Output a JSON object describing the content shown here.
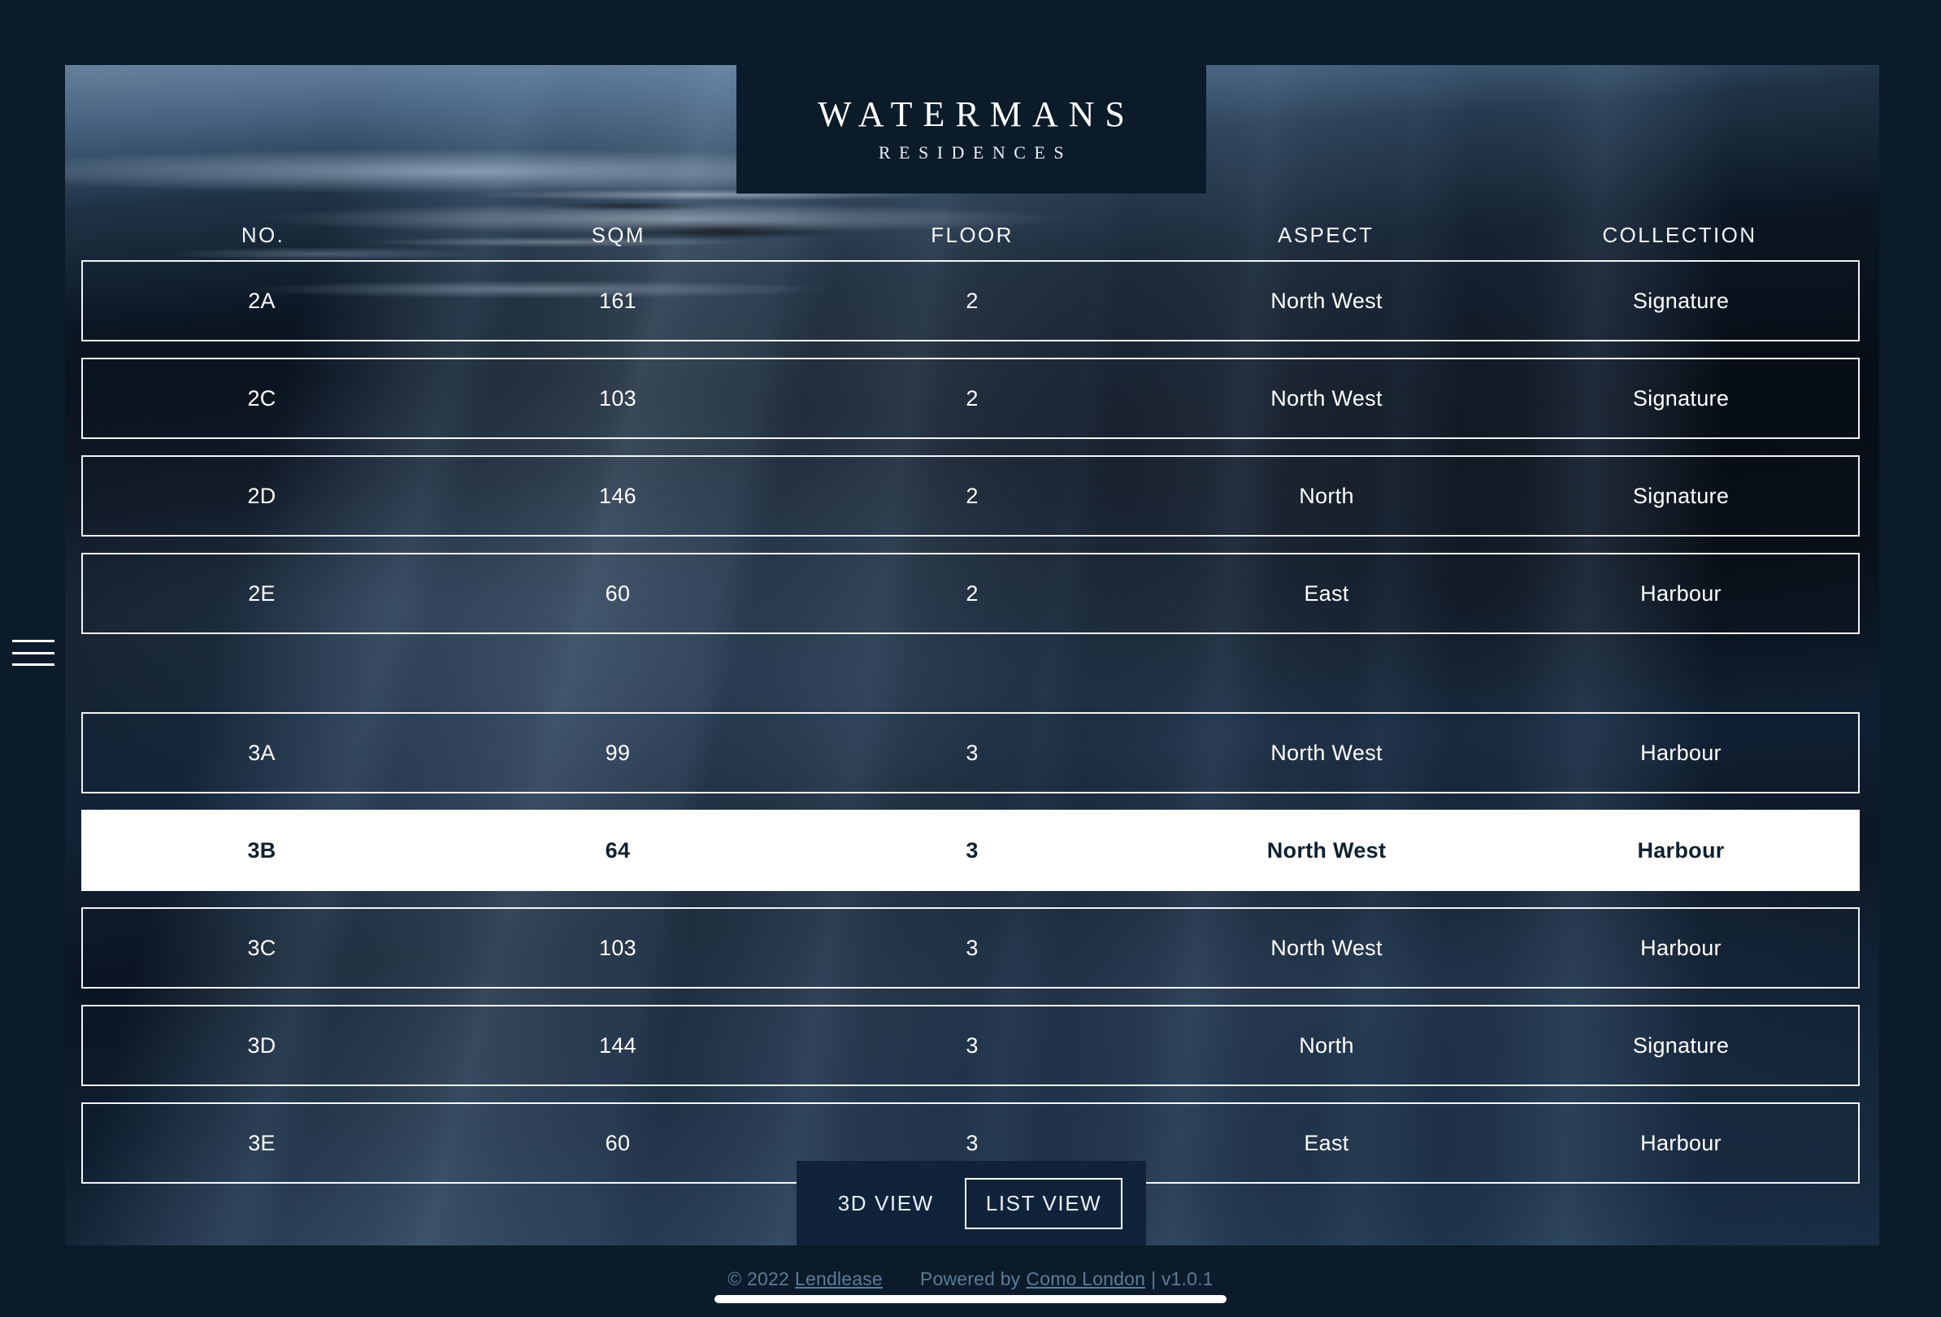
{
  "brand": {
    "name": "WATERMANS",
    "sub": "RESIDENCES"
  },
  "menu": {
    "label": "menu"
  },
  "table": {
    "headers": {
      "no": "NO.",
      "sqm": "SQM",
      "floor": "FLOOR",
      "aspect": "ASPECT",
      "collection": "COLLECTION"
    },
    "groups": [
      {
        "floor": "2",
        "rows": [
          {
            "no": "2A",
            "sqm": "161",
            "floor": "2",
            "aspect": "North West",
            "collection": "Signature",
            "selected": false
          },
          {
            "no": "2C",
            "sqm": "103",
            "floor": "2",
            "aspect": "North West",
            "collection": "Signature",
            "selected": false
          },
          {
            "no": "2D",
            "sqm": "146",
            "floor": "2",
            "aspect": "North",
            "collection": "Signature",
            "selected": false
          },
          {
            "no": "2E",
            "sqm": "60",
            "floor": "2",
            "aspect": "East",
            "collection": "Harbour",
            "selected": false
          }
        ]
      },
      {
        "floor": "3",
        "rows": [
          {
            "no": "3A",
            "sqm": "99",
            "floor": "3",
            "aspect": "North West",
            "collection": "Harbour",
            "selected": false
          },
          {
            "no": "3B",
            "sqm": "64",
            "floor": "3",
            "aspect": "North West",
            "collection": "Harbour",
            "selected": true
          },
          {
            "no": "3C",
            "sqm": "103",
            "floor": "3",
            "aspect": "North West",
            "collection": "Harbour",
            "selected": false
          },
          {
            "no": "3D",
            "sqm": "144",
            "floor": "3",
            "aspect": "North",
            "collection": "Signature",
            "selected": false
          },
          {
            "no": "3E",
            "sqm": "60",
            "floor": "3",
            "aspect": "East",
            "collection": "Harbour",
            "selected": false
          }
        ]
      }
    ]
  },
  "view_toggle": {
    "view_3d": "3D VIEW",
    "view_list": "LIST VIEW",
    "active": "LIST VIEW"
  },
  "footer": {
    "copyright_prefix": "© 2022",
    "copyright_link": "Lendlease",
    "powered_prefix": "Powered by",
    "powered_link": "Como London",
    "version": "| v1.0.1"
  },
  "colors": {
    "page_background": "#0c1b29",
    "panel_background": "#10233a",
    "row_border": "#ffffff",
    "selected_row_background": "#ffffff",
    "selected_row_text": "#10202e",
    "footer_text": "#5d7b97"
  }
}
